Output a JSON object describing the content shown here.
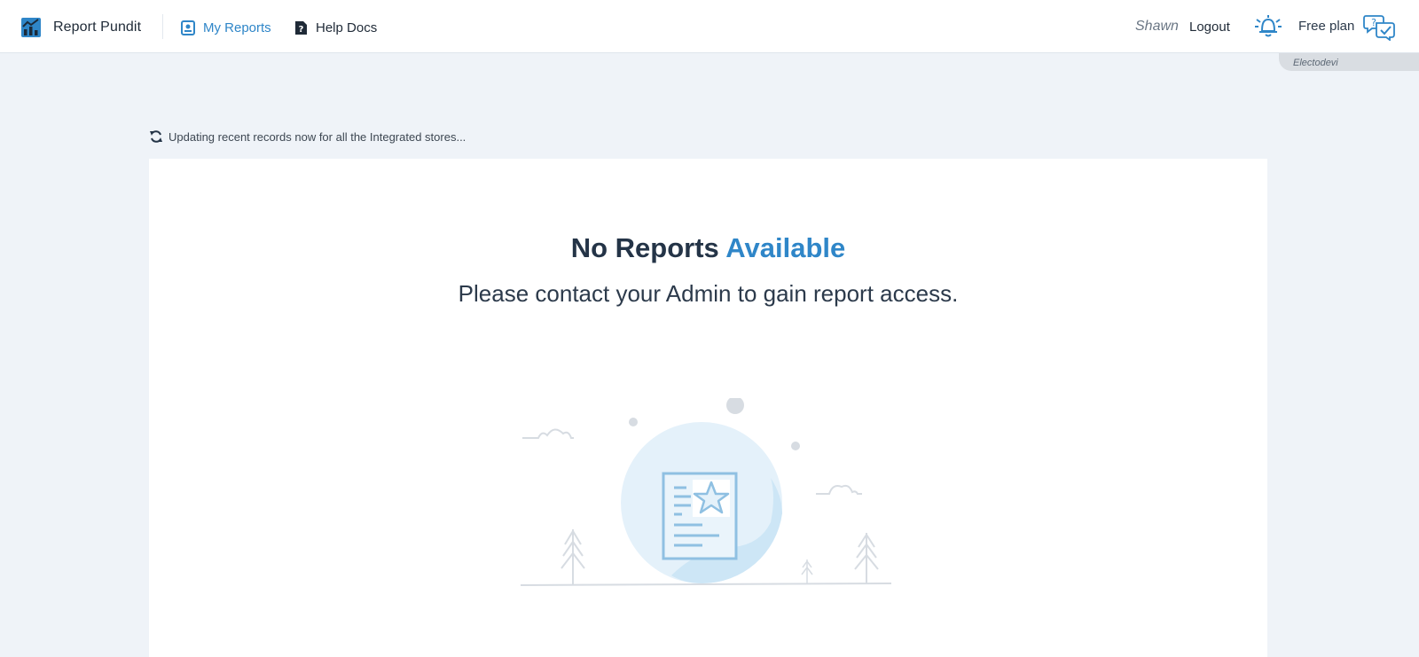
{
  "app": {
    "name": "Report Pundit"
  },
  "nav": {
    "items": [
      {
        "label": "My Reports",
        "icon": "reports-icon",
        "active": true
      },
      {
        "label": "Help Docs",
        "icon": "help-doc-icon",
        "active": false
      }
    ]
  },
  "user": {
    "name": "Shawn",
    "logout_label": "Logout",
    "plan_label": "Free plan",
    "store_label": "Electodevi"
  },
  "status": {
    "message": "Updating recent records now for all the Integrated stores..."
  },
  "empty_state": {
    "title_main": "No Reports",
    "title_accent": "Available",
    "subtitle": "Please contact your Admin to gain report access."
  },
  "colors": {
    "accent": "#2f86c8",
    "page_bg": "#eff3f8",
    "card_bg": "#ffffff",
    "heading": "#243447"
  },
  "icons": {
    "logo": "chart-logo-icon",
    "notifications": "bell-icon",
    "support": "chat-help-icon",
    "refresh": "refresh-icon"
  }
}
